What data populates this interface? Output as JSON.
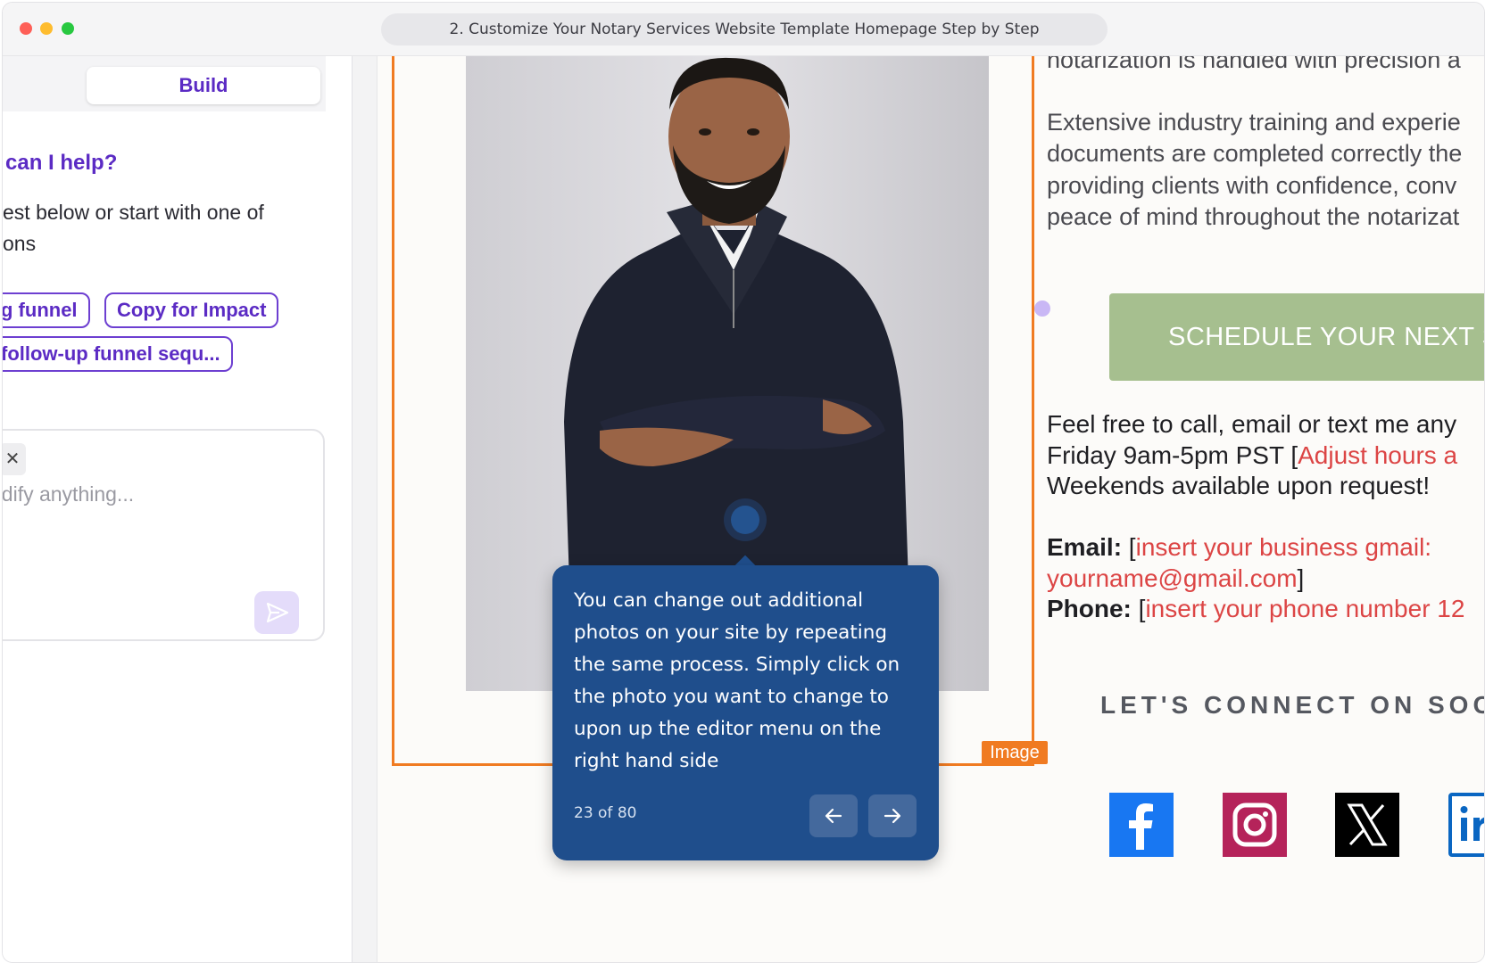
{
  "window": {
    "title": "2. Customize Your Notary Services Website Template Homepage Step by Step"
  },
  "left_panel": {
    "build_label": "Build",
    "help_title": "can I help?",
    "help_sub_line1": "est below or start with one of",
    "help_sub_line2": "ons",
    "chips": [
      "g funnel",
      "Copy for Impact",
      "follow-up funnel sequ..."
    ],
    "input_placeholder": "odify anything..."
  },
  "canvas": {
    "image_tag": "Image",
    "paragraph_lines": [
      "notarization is handled with precision a",
      "Extensive industry training and experie",
      "documents are completed correctly the",
      "providing clients with confidence, conv",
      "peace of mind throughout the notarizat"
    ],
    "schedule_button": "SCHEDULE YOUR NEXT S",
    "contact": {
      "line1": "Feel free to call, email or text me any",
      "line2_prefix": "Friday 9am-5pm PST [",
      "line2_red": "Adjust hours a",
      "line3": "Weekends available upon request!",
      "email_label": "Email:",
      "email_bracket_open": " [",
      "email_red1": "insert your business gmail:",
      "email_red2": "yourname@gmail.com",
      "email_bracket_close": "]",
      "phone_label": "Phone:",
      "phone_bracket_open": " [",
      "phone_red": "insert your phone number 12"
    },
    "social_title": "LET'S CONNECT ON SOCI",
    "social_icons": [
      "facebook-icon",
      "instagram-icon",
      "x-icon",
      "linkedin-icon"
    ]
  },
  "tooltip": {
    "text": "You can change out additional photos on your site by repeating the same process. Simply click on the photo you want to change to upon up the editor menu on the right hand side",
    "counter": "23 of 80"
  },
  "colors": {
    "accent_purple": "#5b2bc4",
    "frame_orange": "#f07b22",
    "tooltip_blue": "#1f4e8c",
    "button_green": "#a6bf8f",
    "placeholder_red": "#dc4545"
  }
}
